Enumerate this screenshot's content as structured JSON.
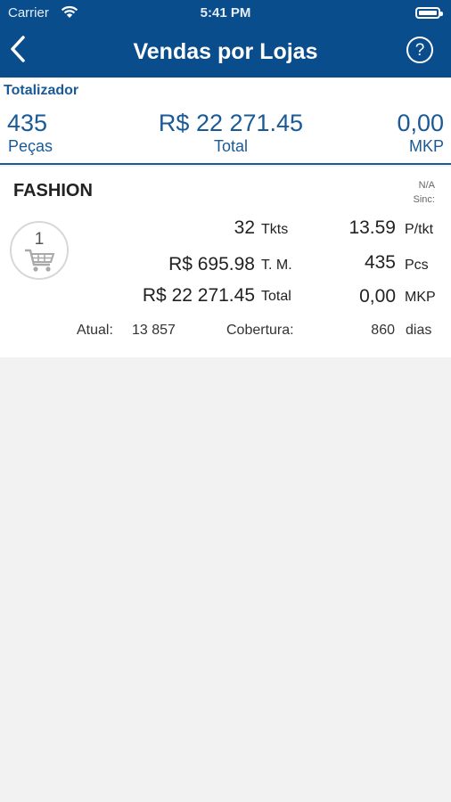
{
  "status_bar": {
    "carrier": "Carrier",
    "time": "5:41 PM"
  },
  "header": {
    "title": "Vendas por Lojas",
    "help_label": "?"
  },
  "totals": {
    "label": "Totalizador",
    "pieces_value": "435",
    "pieces_label": "Peças",
    "total_value": "R$ 22 271.45",
    "total_label": "Total",
    "mkp_value": "0,00",
    "mkp_label": "MKP"
  },
  "store": {
    "name": "FASHION",
    "na": "N/A",
    "sinc": "Sinc:",
    "badge_count": "1",
    "tkts_value": "32",
    "tkts_unit": "Tkts",
    "ptkt_value": "13.59",
    "ptkt_unit": "P/tkt",
    "tm_value": "R$ 695.98",
    "tm_unit": "T. M.",
    "pcs_value": "435",
    "pcs_unit": "Pcs",
    "total_value": "R$ 22 271.45",
    "total_unit": "Total",
    "mkp_value": "0,00",
    "mkp_unit": "MKP",
    "atual_label": "Atual:",
    "atual_value": "13 857",
    "cobertura_label": "Cobertura:",
    "cobertura_value": "860",
    "cobertura_unit": "dias"
  }
}
